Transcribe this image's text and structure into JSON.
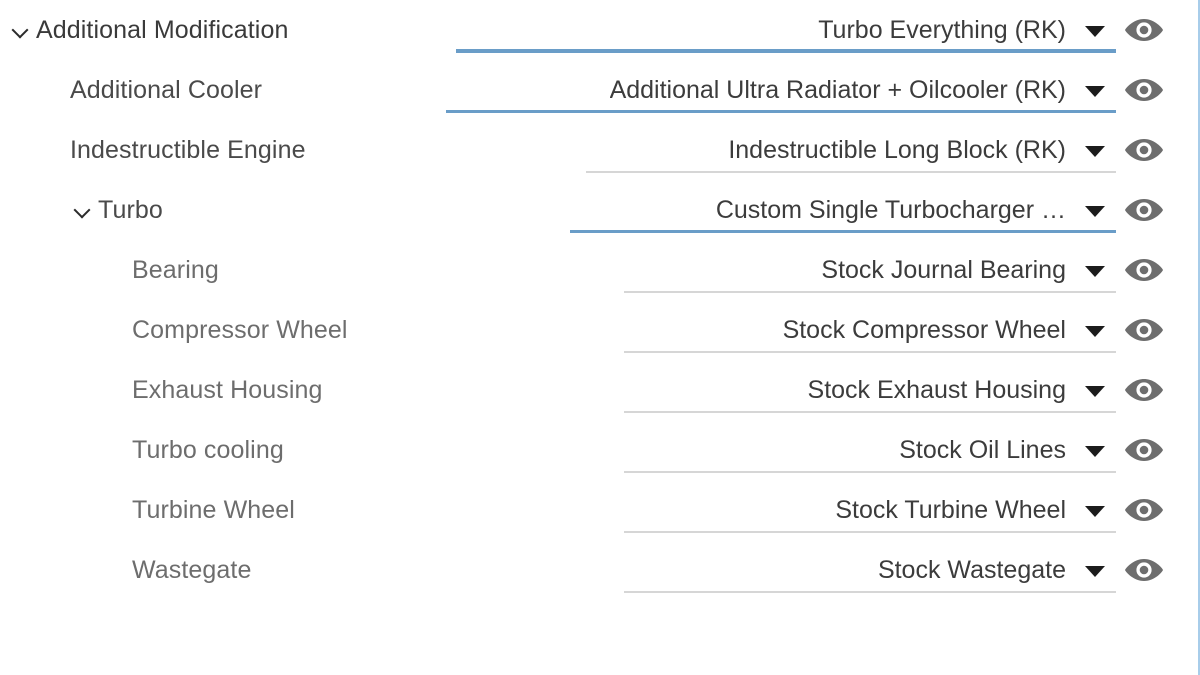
{
  "panel": {
    "title": "Additional Modification",
    "accent_color": "#6a9dc8",
    "border_color": "#a8cdea",
    "label_color": "#3a3a3a",
    "sublabel_color": "#6d6d6d",
    "value_color": "#3c3c3c"
  },
  "icons": {
    "expand_chevron": "chevron-down-icon",
    "dropdown_caret": "caret-down-icon",
    "visibility": "eye-icon"
  },
  "rows": [
    {
      "label": "Additional Modification",
      "value": "Turbo Everything (RK)",
      "depth": 0,
      "expandable": true,
      "expanded": true,
      "underline": "accent"
    },
    {
      "label": "Additional Cooler",
      "value": "Additional Ultra Radiator + Oilcooler (RK)",
      "depth": 1,
      "expandable": false,
      "expanded": false,
      "underline": "accent"
    },
    {
      "label": "Indestructible Engine",
      "value": "Indestructible Long Block (RK)",
      "depth": 1,
      "expandable": false,
      "expanded": false,
      "underline": "plain"
    },
    {
      "label": "Turbo",
      "value": "Custom Single Turbocharger …",
      "depth": 2,
      "expandable": true,
      "expanded": true,
      "underline": "accent"
    },
    {
      "label": "Bearing",
      "value": "Stock Journal Bearing",
      "depth": 3,
      "expandable": false,
      "expanded": false,
      "underline": "plain"
    },
    {
      "label": "Compressor Wheel",
      "value": "Stock Compressor Wheel",
      "depth": 3,
      "expandable": false,
      "expanded": false,
      "underline": "plain"
    },
    {
      "label": "Exhaust Housing",
      "value": "Stock Exhaust Housing",
      "depth": 3,
      "expandable": false,
      "expanded": false,
      "underline": "plain"
    },
    {
      "label": "Turbo cooling",
      "value": "Stock Oil Lines",
      "depth": 3,
      "expandable": false,
      "expanded": false,
      "underline": "plain"
    },
    {
      "label": "Turbine Wheel",
      "value": "Stock Turbine Wheel",
      "depth": 3,
      "expandable": false,
      "expanded": false,
      "underline": "plain"
    },
    {
      "label": "Wastegate",
      "value": "Stock Wastegate",
      "depth": 3,
      "expandable": false,
      "expanded": false,
      "underline": "plain"
    }
  ]
}
